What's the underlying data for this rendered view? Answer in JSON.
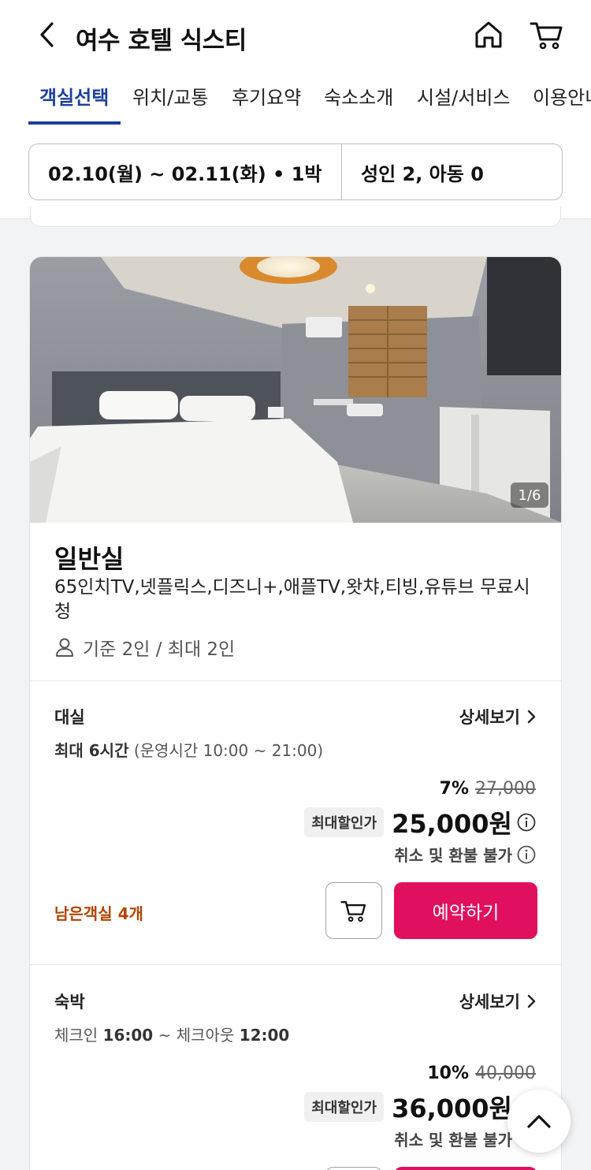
{
  "header": {
    "title": "여수 호텔 식스티"
  },
  "tabs": [
    {
      "label": "객실선택",
      "active": true
    },
    {
      "label": "위치/교통"
    },
    {
      "label": "후기요약"
    },
    {
      "label": "숙소소개"
    },
    {
      "label": "시설/서비스"
    },
    {
      "label": "이용안내"
    }
  ],
  "search": {
    "dates": "02.10(월) ~ 02.11(화) • 1박",
    "guests": "성인 2, 아동 0"
  },
  "room": {
    "photo_counter": "1/6",
    "name": "일반실",
    "description": "65인치TV,넷플릭스,디즈니+,애플TV,왓챠,티빙,유튜브 무료시청",
    "capacity": "기준 2인 / 최대 2인"
  },
  "options": [
    {
      "title": "대실",
      "detail_label": "상세보기",
      "time_prefix": "최대 6시간",
      "time_suffix": "(운영시간 10:00 ~ 21:00)",
      "discount": "7%",
      "original_price": "27,000",
      "badge": "최대할인가",
      "sale_price": "25,000원",
      "refund": "취소 및 환불 불가",
      "remaining": "남은객실 4개",
      "reserve_label": "예약하기"
    },
    {
      "title": "숙박",
      "detail_label": "상세보기",
      "checkin_label": "체크인",
      "checkin_time": "16:00",
      "checkout_label": "체크아웃",
      "checkout_time": "12:00",
      "discount": "10%",
      "original_price": "40,000",
      "badge": "최대할인가",
      "sale_price": "36,000원",
      "refund": "취소 및 환불 불가"
    }
  ],
  "colors": {
    "accent": "#1d3f9c",
    "reserve": "#e0105f",
    "remaining": "#b34400"
  }
}
